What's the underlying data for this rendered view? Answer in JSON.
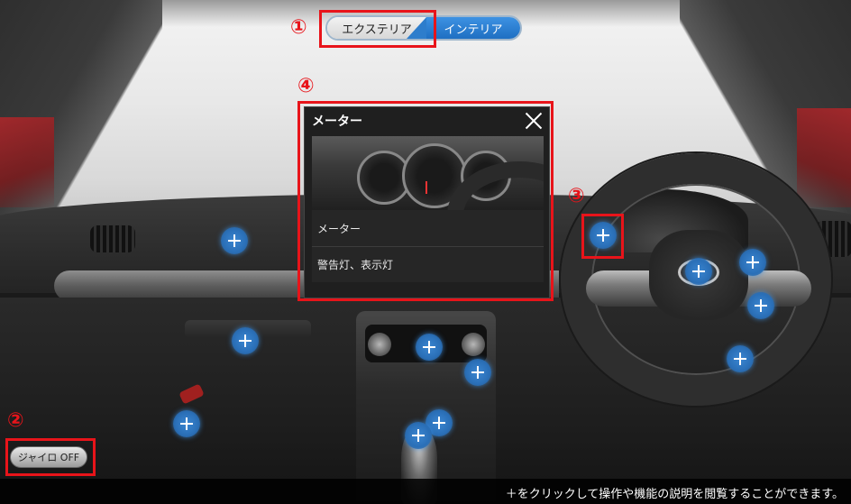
{
  "view_toggle": {
    "exterior_label": "エクステリア",
    "interior_label": "インテリア",
    "selected": "exterior"
  },
  "popup": {
    "title": "メーター",
    "items": [
      {
        "label": "メーター"
      },
      {
        "label": "警告灯、表示灯"
      }
    ]
  },
  "gyro": {
    "label": "ジャイロ OFF",
    "state": "off"
  },
  "help": {
    "text": "＋をクリックして操作や機能の説明を閲覧することができます。"
  },
  "annotations": [
    "①",
    "②",
    "③",
    "④"
  ],
  "colors": {
    "accent_blue": "#2d7dcc",
    "highlight_red": "#e8141a",
    "hotspot_blue": "#2a6fb7"
  },
  "icons": {
    "hotspot": "plus-icon",
    "close": "close-icon"
  }
}
